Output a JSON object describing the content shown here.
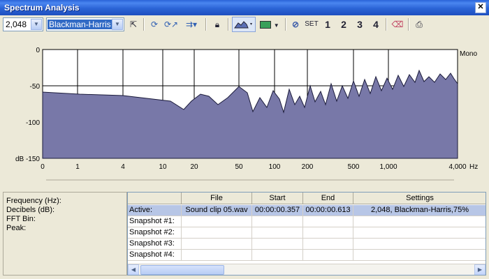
{
  "window": {
    "title": "Spectrum Analysis",
    "close_label": "✕"
  },
  "toolbar": {
    "fft_size": "2,048",
    "window_fn": "Blackman-Harris",
    "set_label": "SET",
    "snap1": "1",
    "snap2": "2",
    "snap3": "3",
    "snap4": "4"
  },
  "graph": {
    "channel": "Mono",
    "y_ticks": [
      "0",
      "-50",
      "-100",
      "dB -150"
    ],
    "x_ticks": [
      "0",
      "1",
      "4",
      "10",
      "20",
      "50",
      "100",
      "200",
      "500",
      "1,000",
      "4,000"
    ],
    "x_unit": "Hz",
    "fill_color": "#7878a8",
    "line_color": "#1a1a3a"
  },
  "info": {
    "frequency": "Frequency (Hz):",
    "decibels": "Decibels (dB):",
    "fft_bin": "FFT Bin:",
    "peak": "Peak:"
  },
  "table": {
    "headers": [
      "File",
      "Start",
      "End",
      "Settings"
    ],
    "rows": [
      {
        "label": "Active:",
        "file": "Sound clip 05.wav",
        "start": "00:00:00.357",
        "end": "00:00:00.613",
        "settings": "2,048, Blackman-Harris,75%"
      },
      {
        "label": "Snapshot #1:",
        "file": "",
        "start": "",
        "end": "",
        "settings": ""
      },
      {
        "label": "Snapshot #2:",
        "file": "",
        "start": "",
        "end": "",
        "settings": ""
      },
      {
        "label": "Snapshot #3:",
        "file": "",
        "start": "",
        "end": "",
        "settings": ""
      },
      {
        "label": "Snapshot #4:",
        "file": "",
        "start": "",
        "end": "",
        "settings": ""
      }
    ]
  }
}
